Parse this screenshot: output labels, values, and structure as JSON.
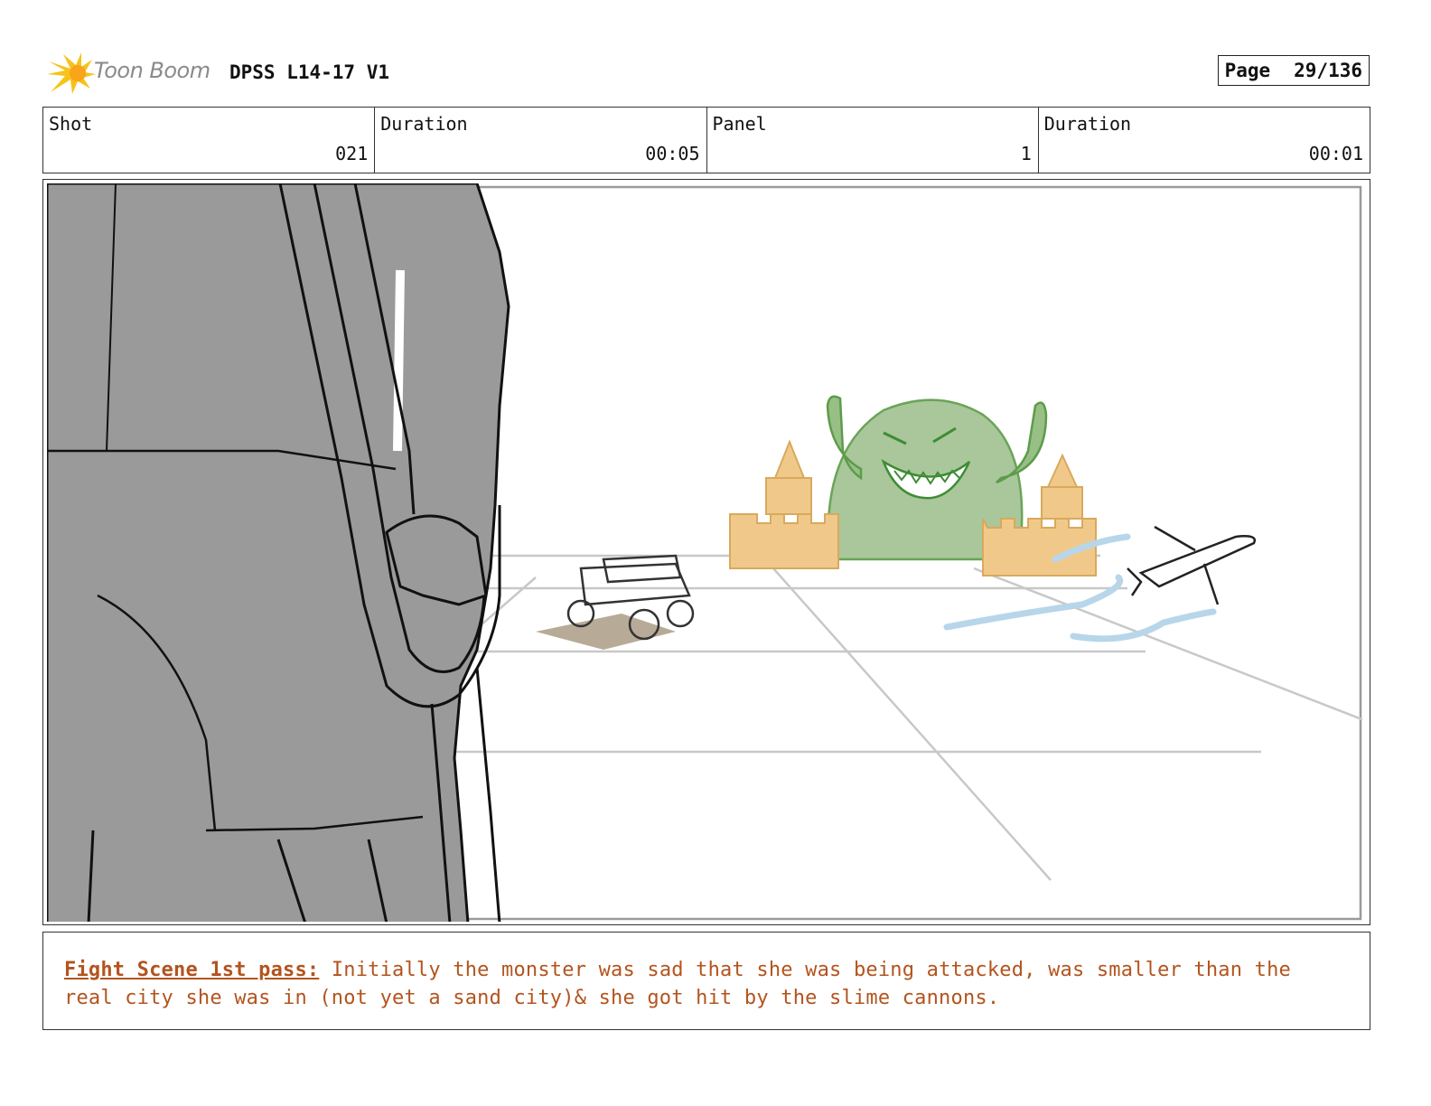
{
  "header": {
    "logo_text": "Toon Boom",
    "title": "DPSS L14-17 V1",
    "page_label": "Page",
    "page_value": "29/136"
  },
  "info": {
    "shot_label": "Shot",
    "shot_value": "021",
    "shot_duration_label": "Duration",
    "shot_duration_value": "00:05",
    "panel_label": "Panel",
    "panel_value": "1",
    "panel_duration_label": "Duration",
    "panel_duration_value": "00:01"
  },
  "caption": {
    "title": "Fight Scene 1st pass:",
    "body": "Initially the monster was sad that she was being attacked, was smaller than the real city she was in (not yet a sand city)& she got hit by the slime cannons."
  },
  "colors": {
    "caption_text": "#b3541e",
    "character_gray": "#9a9a9a",
    "monster_green": "#a9c79a",
    "castle_sand": "#f0c98a",
    "slime_blue": "#b7d6ea",
    "logo_yellow": "#f6c31a"
  }
}
